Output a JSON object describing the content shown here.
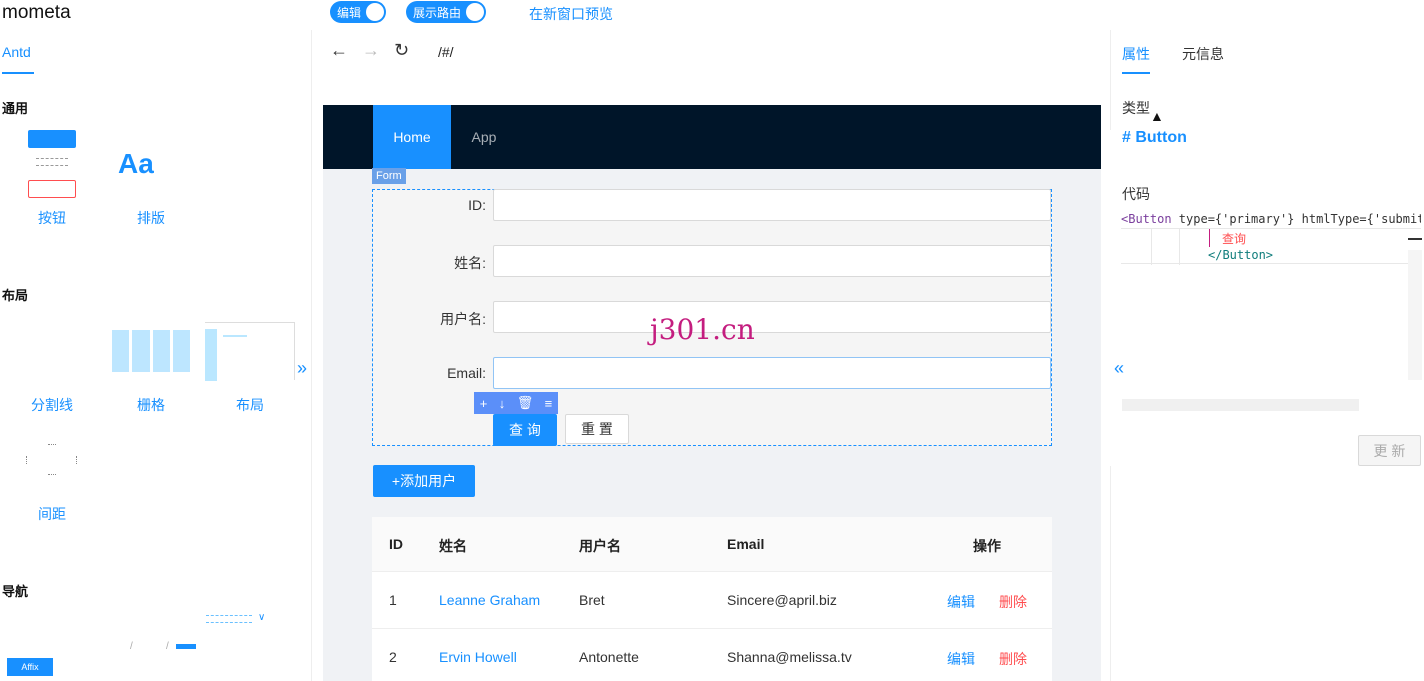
{
  "app": {
    "title": "mometa"
  },
  "topbar": {
    "toggle_edit": "编辑",
    "toggle_route": "展示路由",
    "preview_link": "在新窗口预览"
  },
  "left_panel": {
    "tab": "Antd",
    "sections": [
      {
        "title": "通用",
        "items": [
          "按钮",
          "排版"
        ]
      },
      {
        "title": "布局",
        "items": [
          "分割线",
          "栅格",
          "布局",
          "间距"
        ]
      },
      {
        "title": "导航",
        "items": []
      }
    ],
    "typography_sample": "Aa",
    "affix_label": "Affix"
  },
  "browser": {
    "url": "/#/"
  },
  "preview": {
    "nav": [
      "Home",
      "App"
    ],
    "form_tag": "Form",
    "form_fields": [
      "ID",
      "姓名",
      "用户名",
      "Email"
    ],
    "search_button": "查 询",
    "reset_button": "重 置",
    "add_button": "+添加用户",
    "watermark": "j301.cn",
    "table": {
      "headers": [
        "ID",
        "姓名",
        "用户名",
        "Email",
        "操作"
      ],
      "rows": [
        {
          "id": "1",
          "name": "Leanne Graham",
          "username": "Bret",
          "email": "Sincere@april.biz",
          "edit": "编辑",
          "delete": "删除"
        },
        {
          "id": "2",
          "name": "Ervin Howell",
          "username": "Antonette",
          "email": "Shanna@melissa.tv",
          "edit": "编辑",
          "delete": "删除"
        }
      ]
    }
  },
  "right_panel": {
    "tabs": [
      "属性",
      "元信息"
    ],
    "type_label": "类型",
    "type_value": "Button",
    "code_label": "代码",
    "code_line1_tag": "<Button",
    "code_line1_attrs": " type={'primary'} htmlType={'submit'}",
    "code_line2": "查询",
    "code_line3": "</Button>",
    "update_button": "更 新"
  },
  "colors": {
    "primary": "#1890ff",
    "danger": "#ff4d4f",
    "nav_bg": "#001529"
  }
}
